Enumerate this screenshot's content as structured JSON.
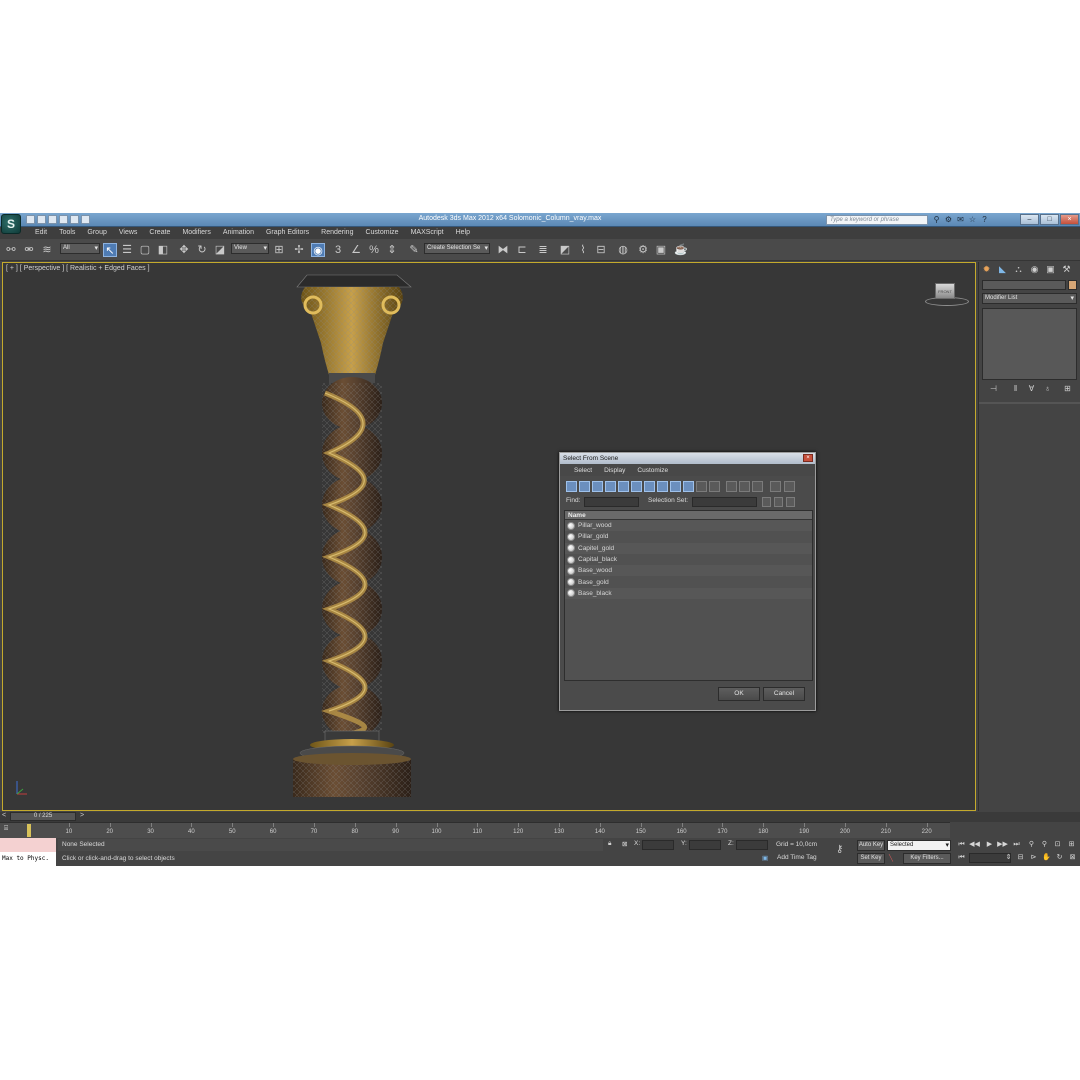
{
  "window": {
    "title": "Autodesk 3ds Max  2012 x64      Solomonic_Column_vray.max",
    "search_placeholder": "Type a keyword or phrase",
    "logo_glyph": "S"
  },
  "menu": [
    "Edit",
    "Tools",
    "Group",
    "Views",
    "Create",
    "Modifiers",
    "Animation",
    "Graph Editors",
    "Rendering",
    "Customize",
    "MAXScript",
    "Help"
  ],
  "toolbar": {
    "selection_filter": "All",
    "reference_coord": "View",
    "named_selection": "Create Selection Se"
  },
  "viewport": {
    "label": "[ + ] [ Perspective ] [ Realistic + Edged Faces ]",
    "viewcube_face": "FRONT"
  },
  "dialog": {
    "title": "Select From Scene",
    "menu": [
      "Select",
      "Display",
      "Customize"
    ],
    "find_label": "Find:",
    "selection_set_label": "Selection Set:",
    "column_header": "Name",
    "objects": [
      "Pillar_wood",
      "Pillar_gold",
      "Capitel_gold",
      "Capital_black",
      "Base_wood",
      "Base_gold",
      "Base_black"
    ],
    "ok_label": "OK",
    "cancel_label": "Cancel"
  },
  "command_panel": {
    "modifier_list": "Modifier List"
  },
  "timeline": {
    "frame_range": "0 / 225",
    "ticks": [
      "10",
      "20",
      "30",
      "40",
      "50",
      "60",
      "70",
      "80",
      "90",
      "100",
      "110",
      "120",
      "130",
      "140",
      "150",
      "160",
      "170",
      "180",
      "190",
      "200",
      "210",
      "220"
    ]
  },
  "status": {
    "maxscript": "Max to Physc.",
    "selection": "None Selected",
    "prompt": "Click or click-and-drag to select objects",
    "x_label": "X:",
    "y_label": "Y:",
    "z_label": "Z:",
    "grid": "Grid = 10,0cm",
    "add_time_tag": "Add Time Tag",
    "auto_key": "Auto Key",
    "set_key": "Set Key",
    "key_mode": "Selected",
    "key_filters": "Key Filters..."
  },
  "colors": {
    "viewport_border": "#c4aa2c",
    "ui_background": "#444444",
    "title_bar": "#6b98c4"
  }
}
